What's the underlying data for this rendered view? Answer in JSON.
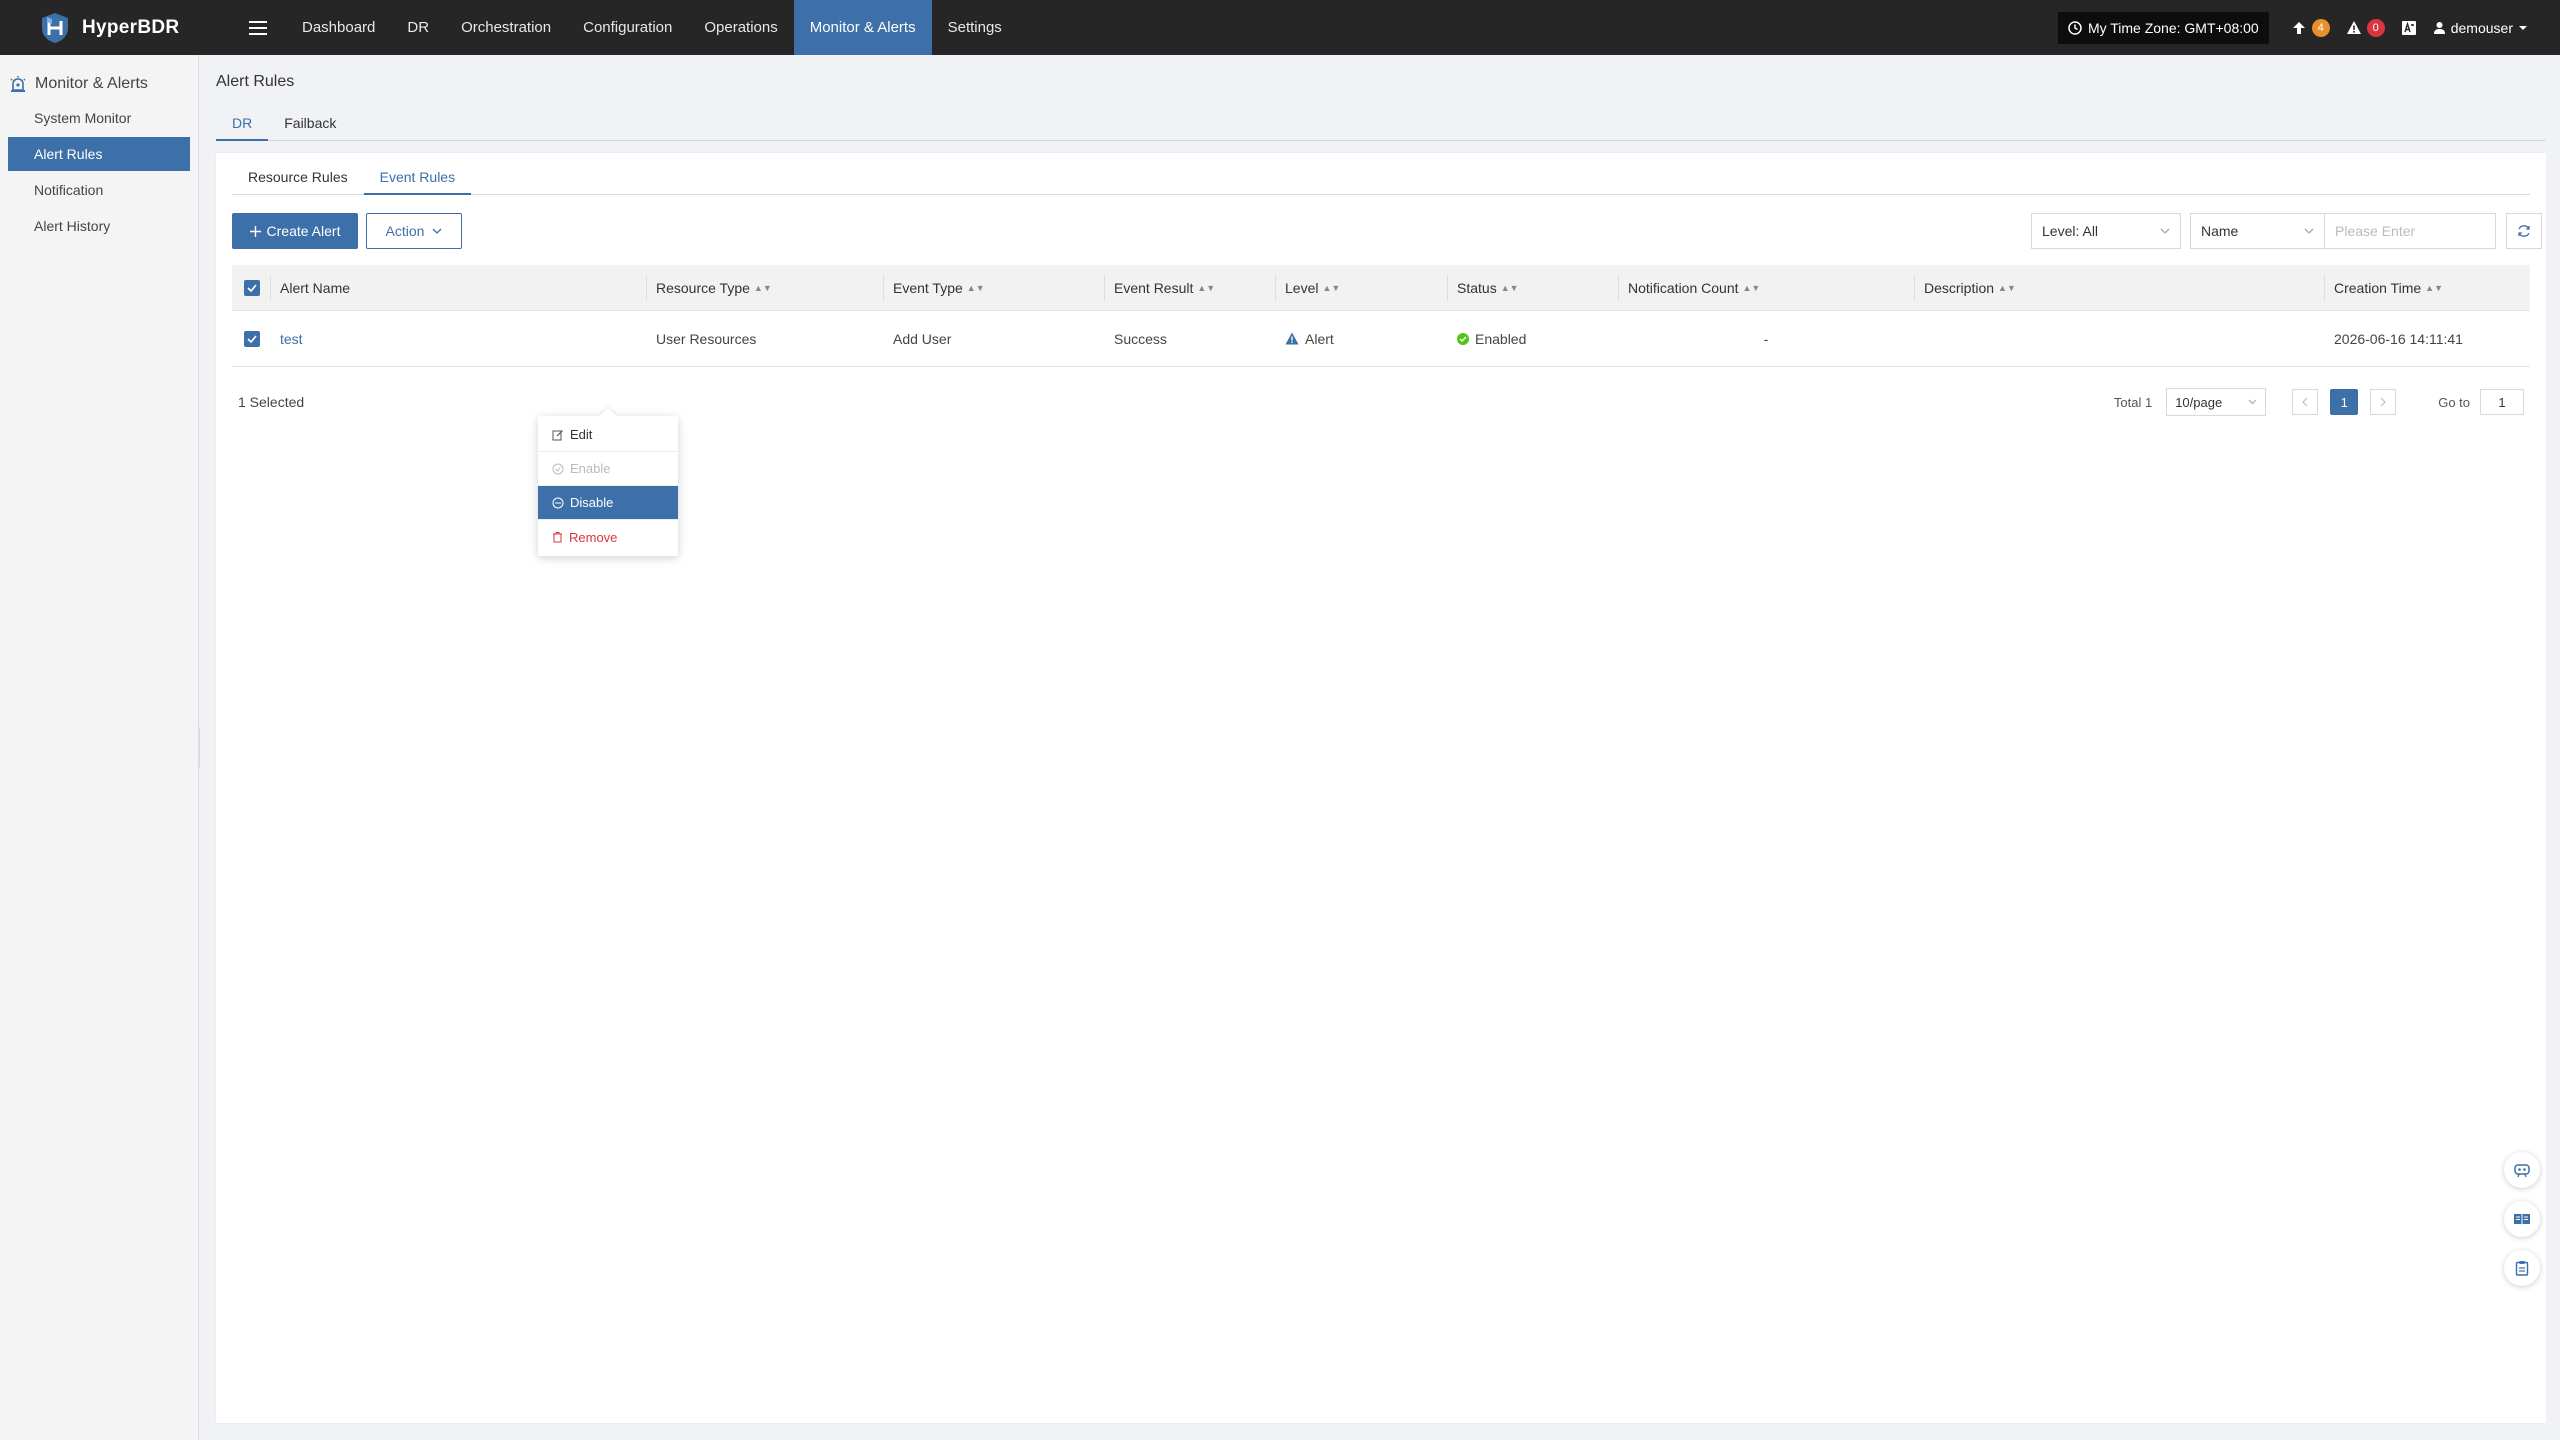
{
  "app": {
    "name": "HyperBDR"
  },
  "topnav": {
    "items": [
      "Dashboard",
      "DR",
      "Orchestration",
      "Configuration",
      "Operations",
      "Monitor & Alerts",
      "Settings"
    ],
    "active": "Monitor & Alerts"
  },
  "header": {
    "timezone": "My Time Zone: GMT+08:00",
    "upgrade_count": "4",
    "alert_count": "0",
    "user": "demouser"
  },
  "sidebar": {
    "title": "Monitor & Alerts",
    "items": [
      {
        "label": "System Monitor"
      },
      {
        "label": "Alert Rules"
      },
      {
        "label": "Notification"
      },
      {
        "label": "Alert History"
      }
    ],
    "active": "Alert Rules"
  },
  "page": {
    "title": "Alert Rules",
    "tabs": [
      "DR",
      "Failback"
    ],
    "active_tab": "DR",
    "inner_tabs": [
      "Resource Rules",
      "Event Rules"
    ],
    "active_inner_tab": "Event Rules"
  },
  "toolbar": {
    "create_label": "Create Alert",
    "action_label": "Action",
    "level_filter": "Level: All",
    "search_field": "Name",
    "search_placeholder": "Please Enter"
  },
  "action_menu": {
    "items": [
      {
        "label": "Edit",
        "icon": "edit-icon",
        "state": "normal"
      },
      {
        "label": "Enable",
        "icon": "enable-icon",
        "state": "disabled"
      },
      {
        "label": "Disable",
        "icon": "disable-icon",
        "state": "highlighted"
      },
      {
        "label": "Remove",
        "icon": "trash-icon",
        "state": "danger"
      }
    ]
  },
  "table": {
    "columns": [
      "Alert Name",
      "Resource Type",
      "Event Type",
      "Event Result",
      "Level",
      "Status",
      "Notification Count",
      "Description",
      "Creation Time"
    ],
    "rows": [
      {
        "name": "test",
        "resource_type": "User Resources",
        "event_type": "Add User",
        "event_result": "Success",
        "level": "Alert",
        "status": "Enabled",
        "notification_count": "-",
        "description": "",
        "creation_time": "2026-06-16 14:11:41"
      }
    ]
  },
  "footer": {
    "selected_text": "1 Selected",
    "total_text": "Total 1",
    "page_size": "10/page",
    "current_page": "1",
    "goto_label": "Go to",
    "goto_value": "1"
  },
  "colors": {
    "accent": "#3d6fa8",
    "topbar": "#262626",
    "success": "#52c41a",
    "danger": "#d9363e",
    "warning_badge": "#e8912c"
  }
}
